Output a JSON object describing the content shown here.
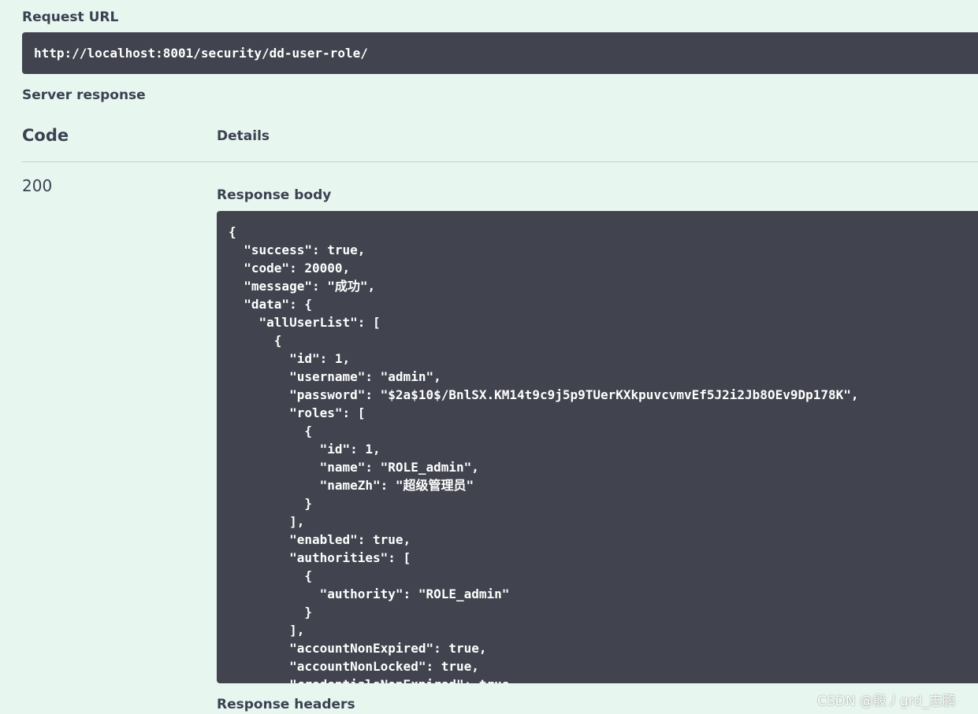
{
  "request": {
    "label": "Request URL",
    "url": "http://localhost:8001/security/dd-user-role/"
  },
  "server_response": {
    "label": "Server response",
    "col_code": "Code",
    "col_details": "Details",
    "status_code": "200",
    "body_label": "Response body",
    "headers_label": "Response headers",
    "body_lines": [
      "{",
      "  \"success\": true,",
      "  \"code\": 20000,",
      "  \"message\": \"成功\",",
      "  \"data\": {",
      "    \"allUserList\": [",
      "      {",
      "        \"id\": 1,",
      "        \"username\": \"admin\",",
      "        \"password\": \"$2a$10$/BnlSX.KM14t9c9j5p9TUerKXkpuvcvmvEf5J2i2Jb8OEv9Dp178K\",",
      "        \"roles\": [",
      "          {",
      "            \"id\": 1,",
      "            \"name\": \"ROLE_admin\",",
      "            \"nameZh\": \"超级管理员\"",
      "          }",
      "        ],",
      "        \"enabled\": true,",
      "        \"authorities\": [",
      "          {",
      "            \"authority\": \"ROLE_admin\"",
      "          }",
      "        ],",
      "        \"accountNonExpired\": true,",
      "        \"accountNonLocked\": true,",
      "        \"credentialsNonExpired\": true,"
    ]
  },
  "watermark": "CSDN @殷丿grd_志鹏"
}
